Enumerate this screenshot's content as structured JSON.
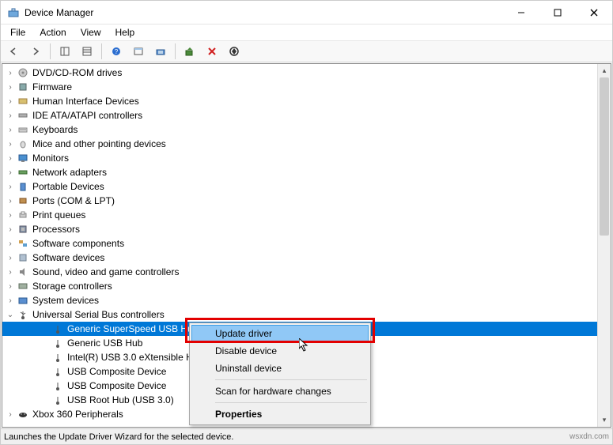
{
  "window": {
    "title": "Device Manager"
  },
  "menubar": {
    "file": "File",
    "action": "Action",
    "view": "View",
    "help": "Help"
  },
  "tree": {
    "nodes": [
      {
        "label": "DVD/CD-ROM drives",
        "icon": "disc"
      },
      {
        "label": "Firmware",
        "icon": "chip"
      },
      {
        "label": "Human Interface Devices",
        "icon": "hid"
      },
      {
        "label": "IDE ATA/ATAPI controllers",
        "icon": "ide"
      },
      {
        "label": "Keyboards",
        "icon": "keyboard"
      },
      {
        "label": "Mice and other pointing devices",
        "icon": "mouse"
      },
      {
        "label": "Monitors",
        "icon": "monitor"
      },
      {
        "label": "Network adapters",
        "icon": "network"
      },
      {
        "label": "Portable Devices",
        "icon": "portable"
      },
      {
        "label": "Ports (COM & LPT)",
        "icon": "port"
      },
      {
        "label": "Print queues",
        "icon": "printer"
      },
      {
        "label": "Processors",
        "icon": "cpu"
      },
      {
        "label": "Software components",
        "icon": "component"
      },
      {
        "label": "Software devices",
        "icon": "softdev"
      },
      {
        "label": "Sound, video and game controllers",
        "icon": "sound"
      },
      {
        "label": "Storage controllers",
        "icon": "storage"
      },
      {
        "label": "System devices",
        "icon": "system"
      }
    ],
    "usb": {
      "label": "Universal Serial Bus controllers",
      "children": [
        "Generic SuperSpeed USB Hub",
        "Generic USB Hub",
        "Intel(R) USB 3.0 eXtensible Ho",
        "USB Composite Device",
        "USB Composite Device",
        "USB Root Hub (USB 3.0)"
      ]
    },
    "xbox": {
      "label": "Xbox 360 Peripherals"
    }
  },
  "context_menu": {
    "update_driver": "Update driver",
    "disable_device": "Disable device",
    "uninstall_device": "Uninstall device",
    "scan": "Scan for hardware changes",
    "properties": "Properties"
  },
  "statusbar": {
    "text": "Launches the Update Driver Wizard for the selected device.",
    "right": "wsxdn.com"
  }
}
